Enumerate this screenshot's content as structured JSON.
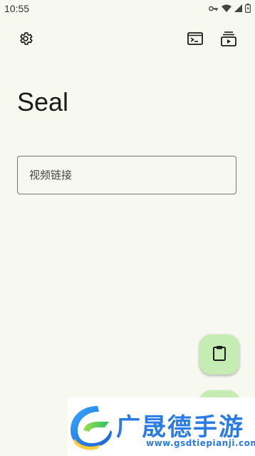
{
  "status_bar": {
    "time": "10:55",
    "icons": [
      "key-icon",
      "wifi-icon",
      "signal-icon",
      "battery-icon"
    ]
  },
  "top_bar": {
    "settings_icon": "gear-icon",
    "terminal_icon": "terminal-icon",
    "queue_icon": "playlist-icon"
  },
  "main": {
    "title": "Seal",
    "url_input": {
      "placeholder": "视频链接",
      "value": ""
    }
  },
  "fab": {
    "icon": "clipboard-icon"
  },
  "watermark": {
    "title": "广晟德手游",
    "url": "www.gsdtiepianji.com"
  },
  "colors": {
    "background": "#f7f8ef",
    "fab": "#c5ecb3",
    "outline": "#75786c",
    "watermark_brand": "#2a7be4"
  }
}
